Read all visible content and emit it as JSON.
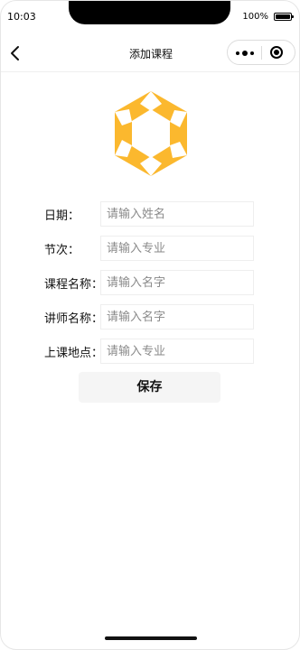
{
  "status_bar": {
    "time": "10:03",
    "battery_percent": "100%"
  },
  "nav": {
    "title": "添加课程",
    "back_icon": "chevron-left-icon",
    "menu_icon": "more-dots-icon",
    "close_icon": "target-circle-icon"
  },
  "logo": {
    "icon": "star-logo-icon",
    "color": "#FBB82E"
  },
  "form": {
    "fields": [
      {
        "label": "日期：",
        "placeholder": "请输入姓名"
      },
      {
        "label": "节次：",
        "placeholder": "请输入专业"
      },
      {
        "label": "课程名称：",
        "placeholder": "请输入名字"
      },
      {
        "label": "讲师名称：",
        "placeholder": "请输入名字"
      },
      {
        "label": "上课地点：",
        "placeholder": "请输入专业"
      }
    ],
    "save_label": "保存"
  }
}
